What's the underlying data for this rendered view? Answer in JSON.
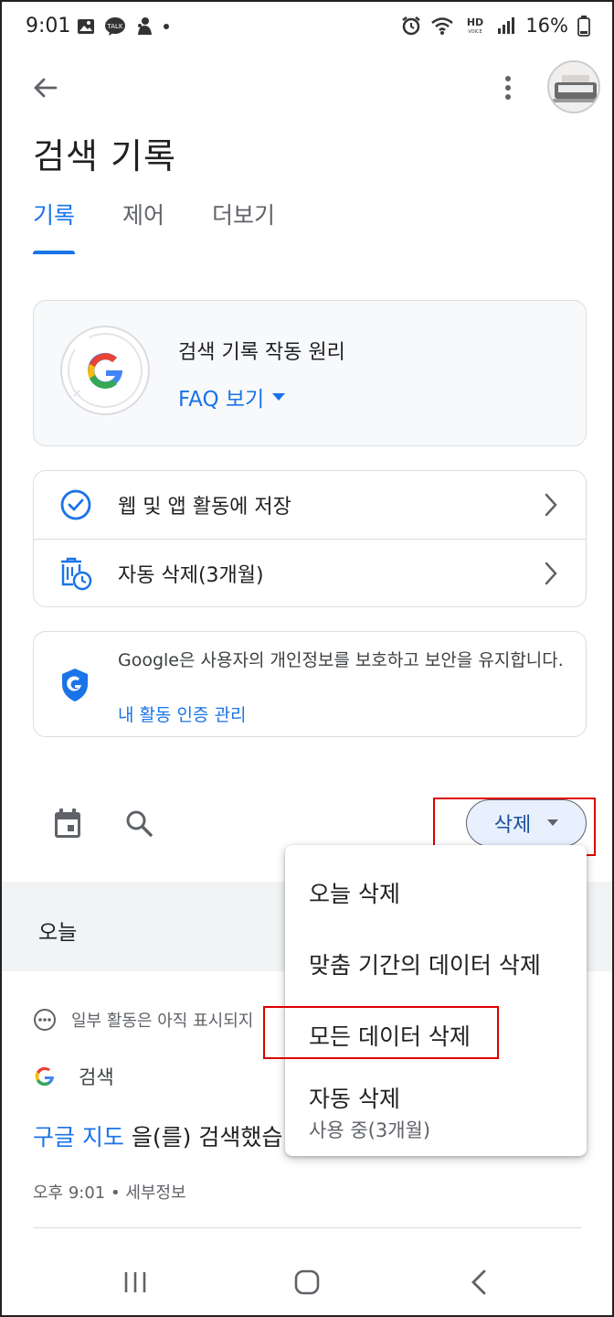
{
  "status_bar": {
    "time": "9:01",
    "battery_percent": "16%",
    "hd_label": "HD",
    "hd_sub": "VOICE",
    "talk_label": "TALK"
  },
  "app_bar": {
    "title": "검색 기록"
  },
  "tabs": [
    {
      "label": "기록",
      "active": true
    },
    {
      "label": "제어",
      "active": false
    },
    {
      "label": "더보기",
      "active": false
    }
  ],
  "faq_card": {
    "title": "검색 기록 작동 원리",
    "link": "FAQ 보기"
  },
  "settings": [
    {
      "label": "웹 및 앱 활동에 저장",
      "icon": "check-circle-icon"
    },
    {
      "label": "자동 삭제(3개월)",
      "icon": "auto-delete-icon"
    }
  ],
  "privacy_card": {
    "text": "Google은 사용자의 개인정보를 보호하고 보안을 유지합니다.",
    "link": "내 활동 인증 관리"
  },
  "toolbar": {
    "delete_label": "삭제"
  },
  "today_section": {
    "label": "오늘",
    "pending_text": "일부 활동은 아직 표시되지",
    "source_label": "검색",
    "query": "구글 지도",
    "query_suffix": " 을(를) 검색했습",
    "meta": "오후 9:01 • 세부정보"
  },
  "delete_menu": {
    "items": [
      {
        "label": "오늘 삭제"
      },
      {
        "label": "맞춤 기간의 데이터 삭제"
      },
      {
        "label": "모든 데이터 삭제"
      },
      {
        "label": "자동 삭제",
        "sublabel": "사용 중(3개월)"
      }
    ]
  },
  "colors": {
    "accent": "#1a73e8",
    "highlight_box": "#dd0000"
  }
}
